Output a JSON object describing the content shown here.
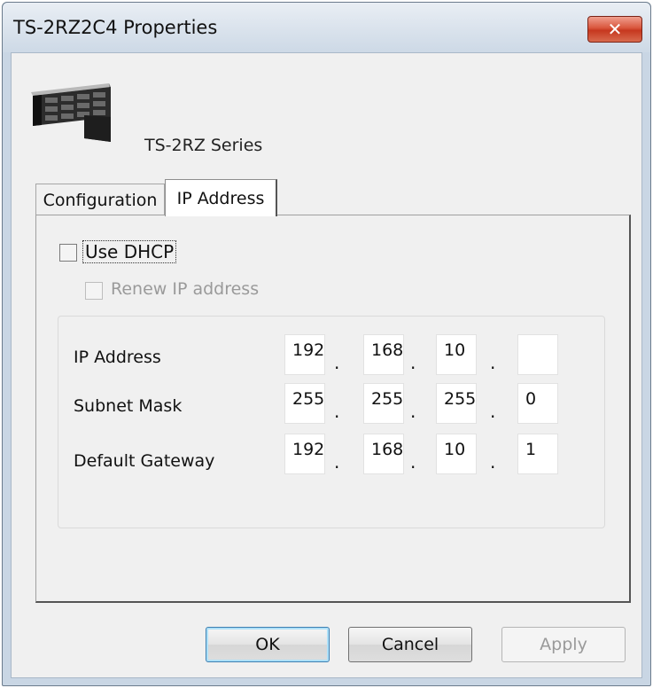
{
  "window": {
    "title": "TS-2RZ2C4 Properties",
    "close_label": "✕"
  },
  "device": {
    "series": "TS-2RZ Series"
  },
  "tabs": [
    {
      "label": "Configuration",
      "active": false
    },
    {
      "label": "IP Address",
      "active": true
    }
  ],
  "dhcp": {
    "use_dhcp_label": "Use DHCP",
    "use_dhcp_checked": false,
    "renew_label": "Renew IP address",
    "renew_checked": false,
    "renew_enabled": false
  },
  "fields": {
    "ip_address": {
      "label": "IP Address",
      "octets": [
        "192",
        "168",
        "10",
        ""
      ]
    },
    "subnet_mask": {
      "label": "Subnet Mask",
      "octets": [
        "255",
        "255",
        "255",
        "0"
      ]
    },
    "default_gateway": {
      "label": "Default Gateway",
      "octets": [
        "192",
        "168",
        "10",
        "1"
      ]
    },
    "separator": "."
  },
  "buttons": {
    "ok": "OK",
    "cancel": "Cancel",
    "apply": "Apply"
  },
  "colors": {
    "close_button": "#c6371f",
    "default_button_focus": "#3c7fb1",
    "disabled_text": "#9a9a9a"
  }
}
